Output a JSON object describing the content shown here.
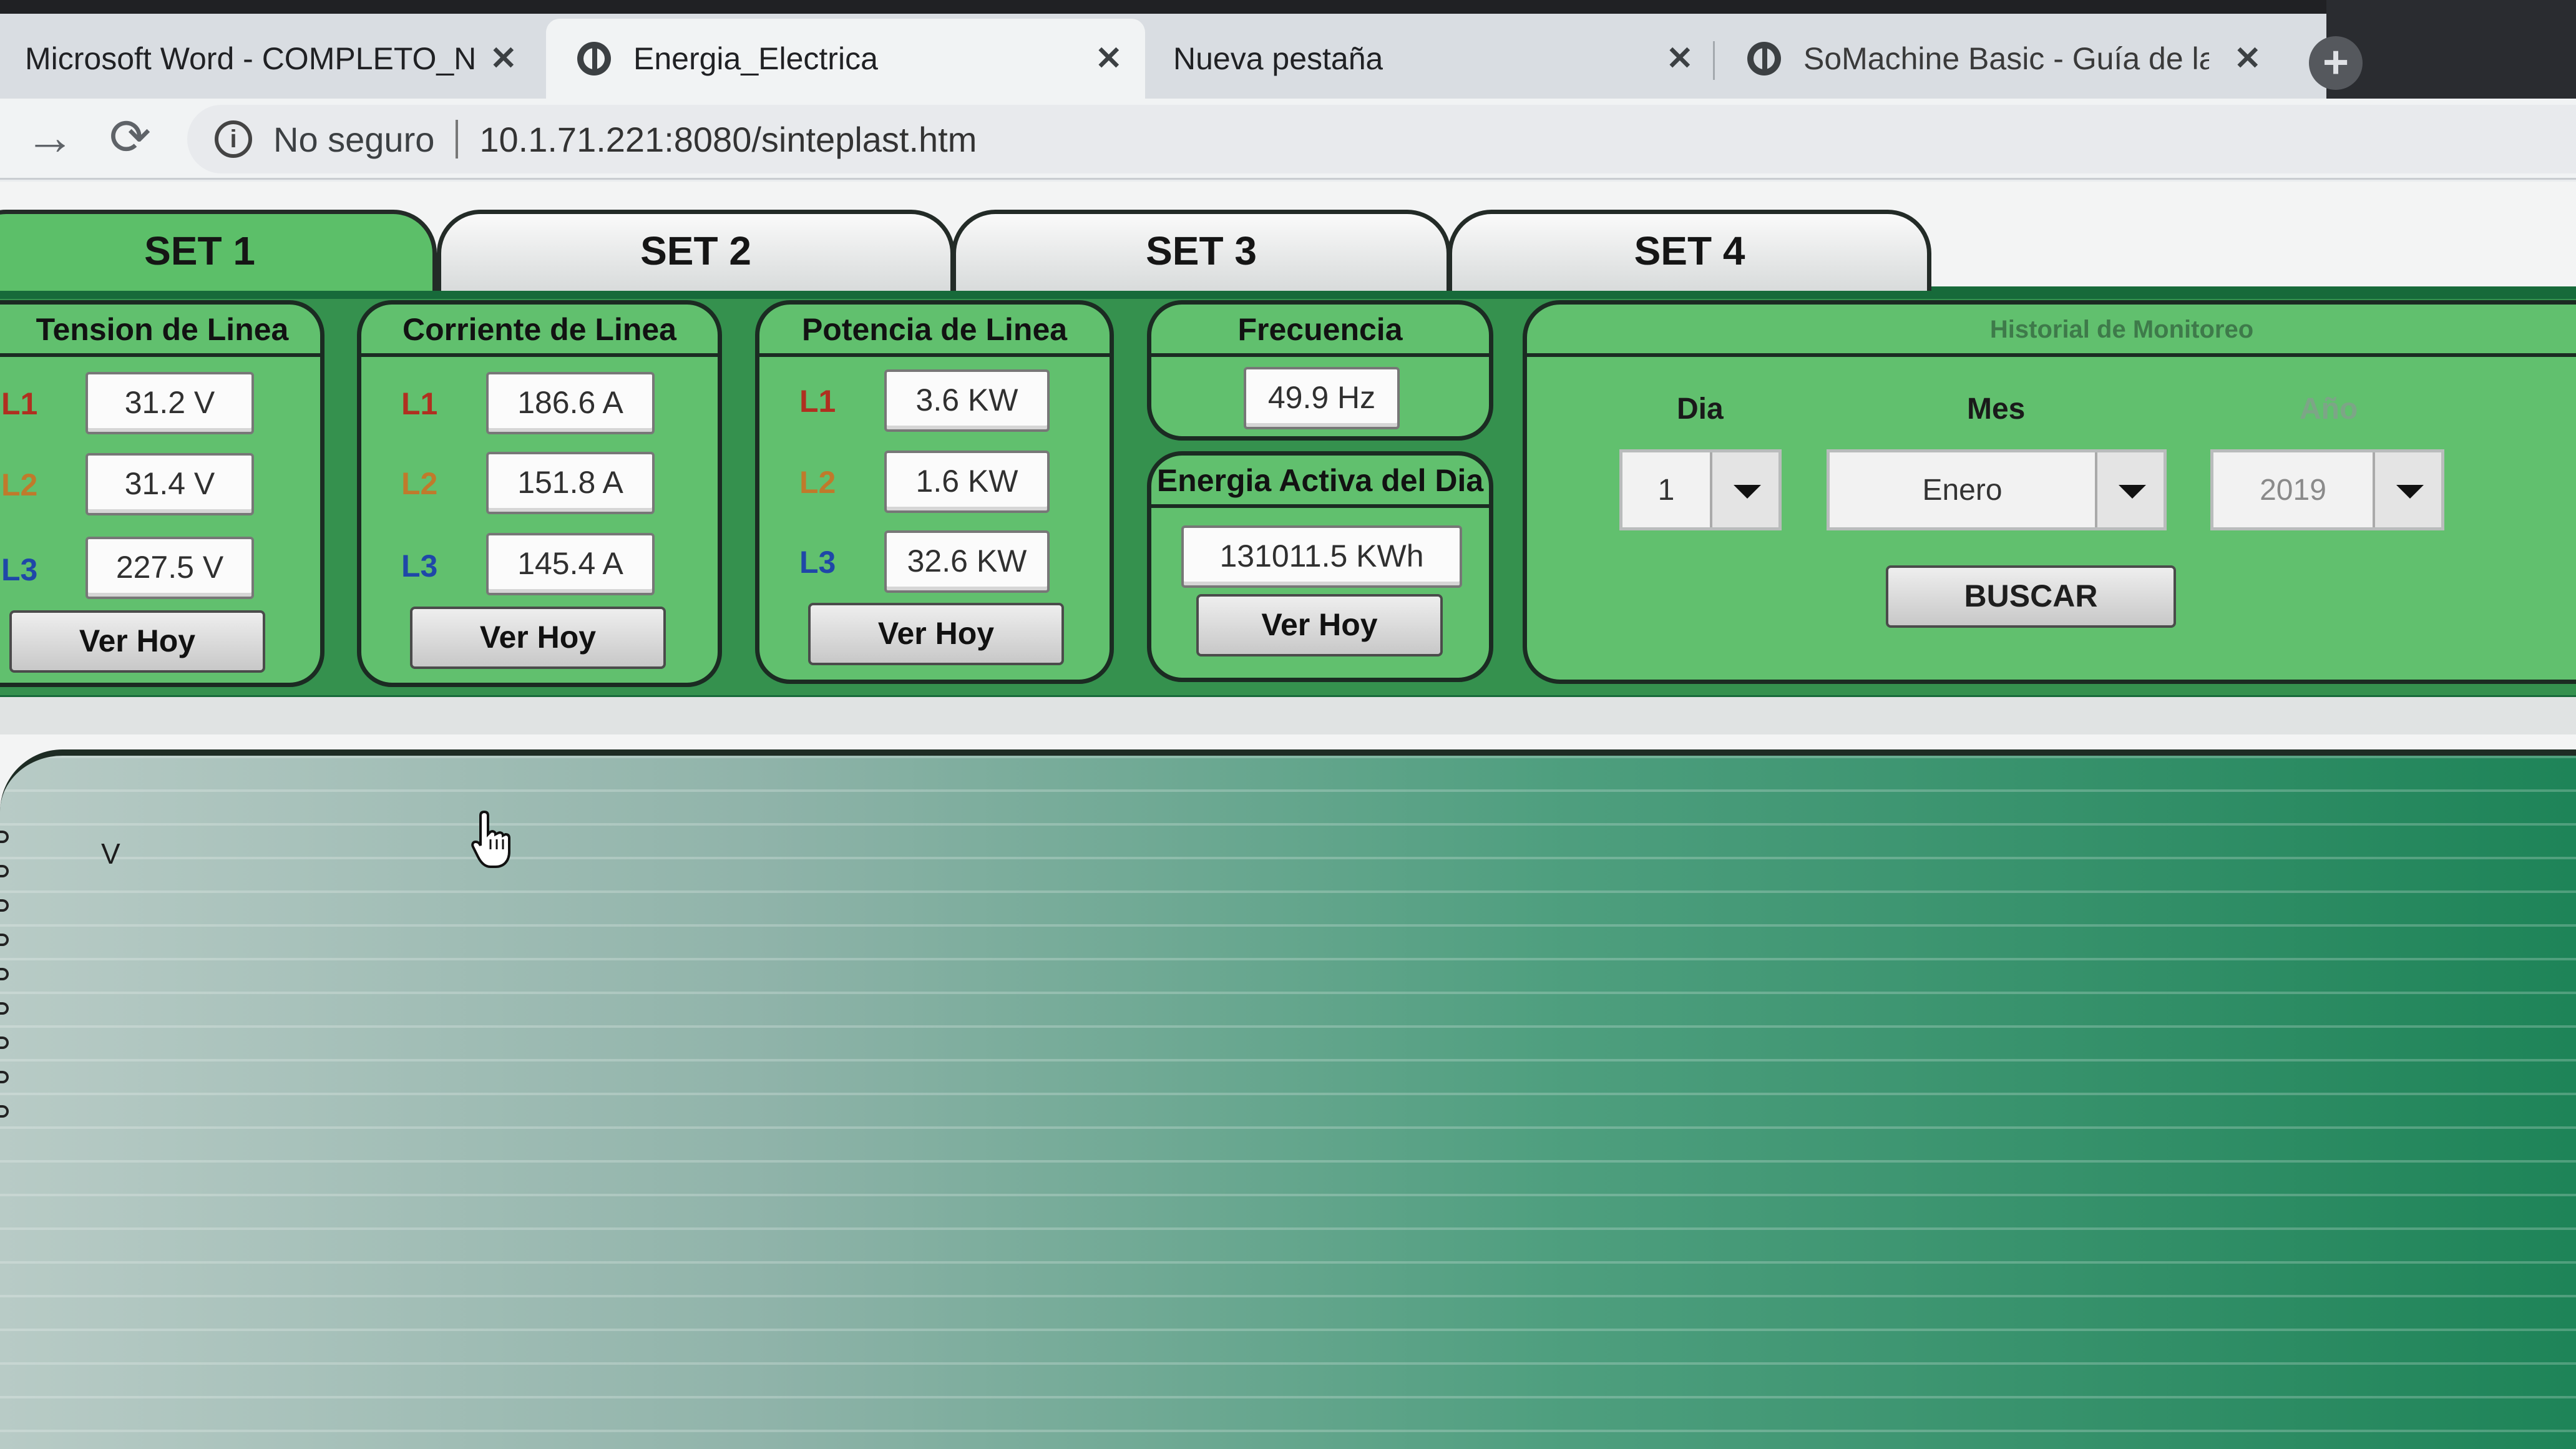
{
  "browser": {
    "tabs": [
      {
        "title": "Microsoft Word - COMPLETO_NF",
        "active": false
      },
      {
        "title": "Energia_Electrica",
        "active": true
      },
      {
        "title": "Nueva pestaña",
        "active": false
      },
      {
        "title": "SoMachine Basic - Guía de la bi",
        "active": false
      }
    ],
    "security_label": "No seguro",
    "url": "10.1.71.221:8080/sinteplast.htm",
    "icons": {
      "close": "close-icon",
      "globe": "globe-icon",
      "newtab": "plus-icon",
      "back": "arrow-icon",
      "reload": "reload-icon",
      "info": "info-icon"
    }
  },
  "sets": [
    "SET 1",
    "SET 2",
    "SET 3",
    "SET 4"
  ],
  "selected_set": "SET 1",
  "panels": {
    "tension": {
      "title": "Tension de Linea",
      "rows": [
        {
          "label": "L1",
          "value": "31.2 V"
        },
        {
          "label": "L2",
          "value": "31.4 V"
        },
        {
          "label": "L3",
          "value": "227.5 V"
        }
      ],
      "button": "Ver Hoy"
    },
    "corriente": {
      "title": "Corriente de Linea",
      "rows": [
        {
          "label": "L1",
          "value": "186.6 A"
        },
        {
          "label": "L2",
          "value": "151.8 A"
        },
        {
          "label": "L3",
          "value": "145.4 A"
        }
      ],
      "button": "Ver Hoy"
    },
    "potencia": {
      "title": "Potencia de Linea",
      "rows": [
        {
          "label": "L1",
          "value": "3.6 KW"
        },
        {
          "label": "L2",
          "value": "1.6 KW"
        },
        {
          "label": "L3",
          "value": "32.6 KW"
        }
      ],
      "button": "Ver Hoy"
    },
    "frecuencia": {
      "title": "Frecuencia",
      "value": "49.9 Hz"
    },
    "energia": {
      "title": "Energia Activa del Dia",
      "value": "131011.5 KWh",
      "button": "Ver Hoy"
    },
    "historial": {
      "title": "Historial de Monitoreo",
      "dia_label": "Dia",
      "dia_value": "1",
      "mes_label": "Mes",
      "mes_value": "Enero",
      "anio_label": "Año",
      "anio_value": "2019",
      "button": "BUSCAR"
    }
  },
  "chart": {
    "unit": "V"
  },
  "colors": {
    "panel_green": "#61c06e",
    "dark_green": "#176a3a",
    "selected_tab": "#5cbf69"
  }
}
